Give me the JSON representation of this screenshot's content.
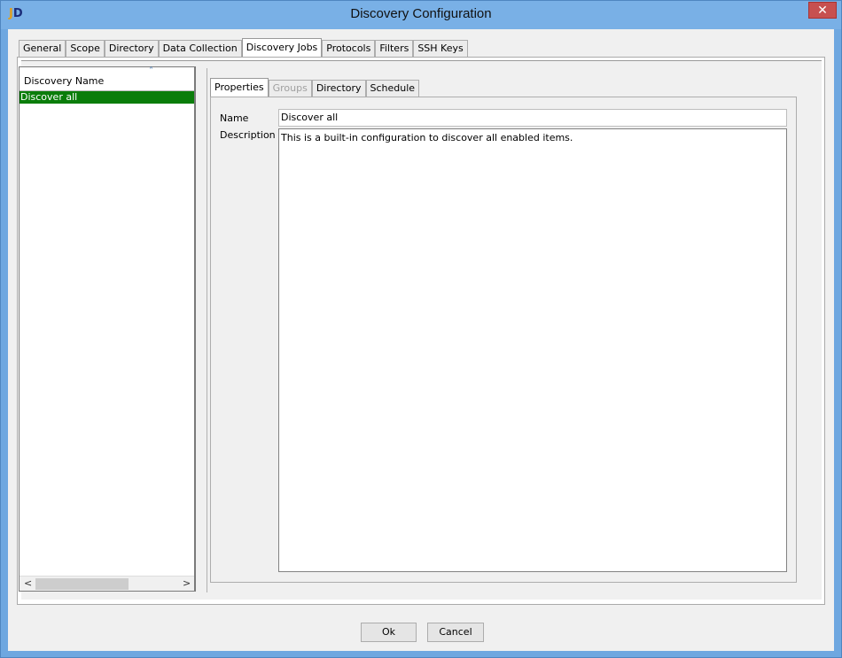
{
  "window": {
    "title": "Discovery Configuration",
    "close_glyph": "✕",
    "icon": "app-logo-icon"
  },
  "tabs": [
    {
      "label": "General"
    },
    {
      "label": "Scope"
    },
    {
      "label": "Directory"
    },
    {
      "label": "Data Collection"
    },
    {
      "label": "Discovery Jobs",
      "active": true
    },
    {
      "label": "Protocols"
    },
    {
      "label": "Filters"
    },
    {
      "label": "SSH Keys"
    }
  ],
  "list": {
    "column_header": "Discovery Name",
    "sort_glyph": "˄",
    "rows": [
      "Discover all"
    ],
    "selected_color": "#0a7d0a"
  },
  "sub_tabs": [
    {
      "label": "Properties",
      "active": true
    },
    {
      "label": "Groups",
      "disabled": true
    },
    {
      "label": "Directory"
    },
    {
      "label": "Schedule"
    }
  ],
  "properties": {
    "name_label": "Name",
    "name_value": "Discover all",
    "description_label": "Description",
    "description_value": "This is a built-in configuration to discover all enabled items."
  },
  "buttons": {
    "ok": "Ok",
    "cancel": "Cancel"
  }
}
